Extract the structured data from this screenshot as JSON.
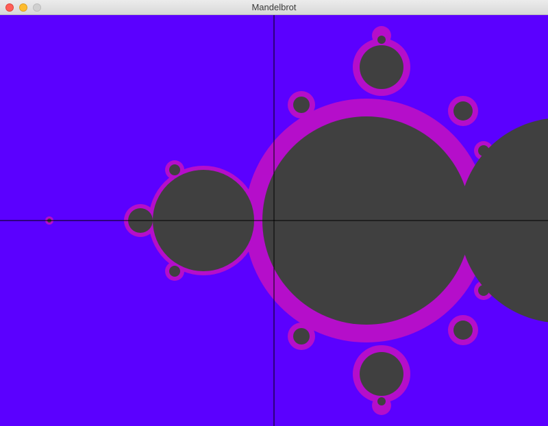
{
  "window": {
    "title": "Mandelbrot"
  },
  "colors": {
    "background": "#5b00ff",
    "set": "#404040",
    "fringe": "#ff1aa0",
    "axis": "#000000"
  },
  "icons": {
    "close": "close-dot-icon",
    "minimize": "minimize-dot-icon",
    "zoom": "zoom-dot-icon"
  }
}
